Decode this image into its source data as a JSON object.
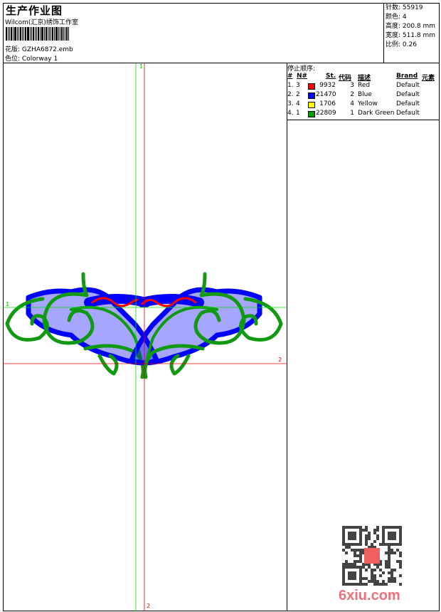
{
  "header": {
    "title": "生产作业图",
    "subtitle": "Wilcom(汇京)绣饰工作室",
    "design_label": "花版:",
    "design_value": "GZHA6872.emb",
    "colorway_label": "色位:",
    "colorway_value": "Colorway 1"
  },
  "info": {
    "stitches": "针数: 55919",
    "colors": "颜色: 4",
    "height": "高度: 200.8 mm",
    "width": "宽度: 511.8 mm",
    "scale": "比例: 0.26"
  },
  "stop_sequence": {
    "title": "停止顺序:",
    "columns": [
      "#",
      "N#",
      "St.",
      "代码",
      "描述",
      "Brand",
      "元素"
    ],
    "rows": [
      {
        "idx": "1.",
        "n": "3",
        "color": "#ff0000",
        "st": "9932",
        "code": "3",
        "desc": "Red",
        "brand": "Default"
      },
      {
        "idx": "2.",
        "n": "2",
        "color": "#0000ff",
        "st": "21470",
        "code": "2",
        "desc": "Blue",
        "brand": "Default"
      },
      {
        "idx": "3.",
        "n": "4",
        "color": "#ffff00",
        "st": "1706",
        "code": "4",
        "desc": "Yellow",
        "brand": "Default"
      },
      {
        "idx": "4.",
        "n": "1",
        "color": "#009900",
        "st": "22809",
        "code": "1",
        "desc": "Dark Green",
        "brand": "Default"
      }
    ]
  },
  "markers": {
    "one": "1",
    "two": "2"
  },
  "watermark": "6xiu.com",
  "colors": {
    "red": "#ff0000",
    "blue": "#0000ff",
    "green": "#119911",
    "guide_green": "#00dd00",
    "guide_red": "#dd0000"
  }
}
